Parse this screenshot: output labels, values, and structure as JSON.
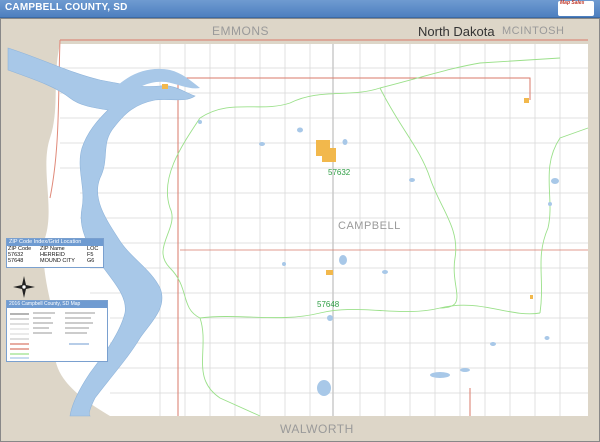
{
  "header": {
    "title": "CAMPBELL COUNTY, SD",
    "logo_text": "Map Sales"
  },
  "map": {
    "labels": {
      "county_north_left": "EMMONS",
      "state_north": "North Dakota",
      "county_north_right": "MCINTOSH",
      "county_center": "CAMPBELL",
      "county_south": "WALWORTH"
    },
    "zip_labels": [
      "57632",
      "57648"
    ],
    "colors": {
      "land": "#ffffff",
      "neighbor_land": "#ddd6c8",
      "water": "#a8c8e8",
      "roads": "#d9d9d9",
      "county_border": "#d97a6a",
      "zip_border": "#9be08a",
      "cities": "#f2b84c"
    }
  },
  "zip_index": {
    "title": "ZIP Code Index/Grid Location",
    "columns": [
      "ZIP Code",
      "ZIP Name",
      "LOC"
    ],
    "rows": [
      [
        "57632",
        "HERREID",
        "F5"
      ],
      [
        "57648",
        "MOUND CITY",
        "G6"
      ]
    ]
  },
  "legend": {
    "title": "2016 Campbell County, SD Map"
  }
}
